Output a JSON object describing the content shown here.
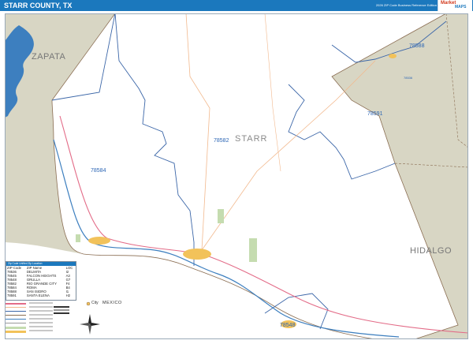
{
  "header": {
    "title": "STARR COUNTY, TX",
    "edition": "2026 ZIP Code Business Reference Edition",
    "logo_top": "Market",
    "logo_bottom": "MAPS"
  },
  "map": {
    "county_name": "STARR",
    "neighbors": [
      "ZAPATA",
      "HIDALGO"
    ],
    "country_label": "MEXICO",
    "colors": {
      "header": "#1b78bd",
      "background_land": "#d8d6c4",
      "county_fill": "#ffffff",
      "water": "#3d7fbf",
      "zip_boundary": "#3b66a8",
      "county_boundary": "#8a6d52",
      "highway": "#e36c88",
      "road": "#f2b98e",
      "urban": "#f2c25a",
      "park": "#c5dcb0"
    },
    "zip_labels": [
      "78588",
      "78591",
      "78582",
      "78584",
      "78548"
    ],
    "small_label": "78536"
  },
  "zip_table": {
    "header": "Zip Code Unified Zip Location",
    "columns": [
      "ZIP Code",
      "ZIP Name",
      "LOC"
    ],
    "rows": [
      [
        "78536",
        "DELMITA",
        "I2"
      ],
      [
        "78545",
        "FALCON HEIGHTS",
        "A3"
      ],
      [
        "78548",
        "GRULLA",
        "G7"
      ],
      [
        "78582",
        "RIO GRANDE CITY",
        "F4"
      ],
      [
        "78584",
        "ROMA",
        "B4"
      ],
      [
        "78588",
        "SAN ISIDRO",
        "I1"
      ],
      [
        "78591",
        "SANTA ELENA",
        "H2"
      ]
    ]
  },
  "legend": {
    "city_symbol_label": "City"
  }
}
